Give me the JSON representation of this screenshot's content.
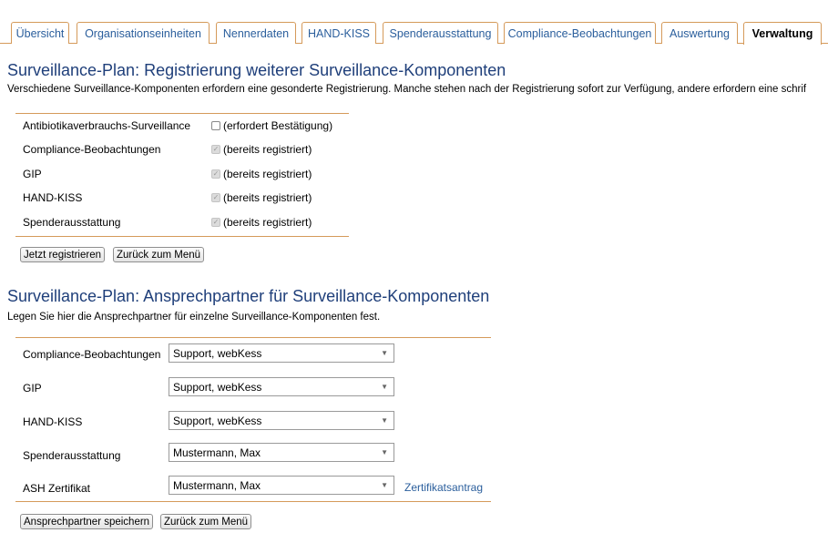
{
  "tabs": [
    {
      "label": "Übersicht"
    },
    {
      "label": "Organisationseinheiten"
    },
    {
      "label": "Nennerdaten"
    },
    {
      "label": "HAND-KISS"
    },
    {
      "label": "Spenderausstattung"
    },
    {
      "label": "Compliance-Beobachtungen"
    },
    {
      "label": "Auswertung"
    },
    {
      "label": "Verwaltung",
      "active": true
    }
  ],
  "registration": {
    "title": "Surveillance-Plan: Registrierung weiterer Surveillance-Komponenten",
    "description": "Verschiedene Surveillance-Komponenten erfordern eine gesonderte Registrierung. Manche stehen nach der Registrierung sofort zur Verfügung, andere erfordern eine schrif",
    "rows": [
      {
        "name": "Antibiotikaverbrauchs-Surveillance",
        "status": "(erfordert Bestätigung)",
        "checked": false,
        "disabled": false
      },
      {
        "name": "Compliance-Beobachtungen",
        "status": "(bereits registriert)",
        "checked": true,
        "disabled": true
      },
      {
        "name": "GIP",
        "status": "(bereits registriert)",
        "checked": true,
        "disabled": true
      },
      {
        "name": "HAND-KISS",
        "status": "(bereits registriert)",
        "checked": true,
        "disabled": true
      },
      {
        "name": "Spenderausstattung",
        "status": "(bereits registriert)",
        "checked": true,
        "disabled": true
      }
    ],
    "register_button": "Jetzt registrieren",
    "back_button": "Zurück zum Menü"
  },
  "contacts": {
    "title": "Surveillance-Plan: Ansprechpartner für Surveillance-Komponenten",
    "description": "Legen Sie hier die Ansprechpartner für einzelne Surveillance-Komponenten fest.",
    "rows": [
      {
        "name": "Compliance-Beobachtungen",
        "value": "Support, webKess"
      },
      {
        "name": "GIP",
        "value": "Support, webKess"
      },
      {
        "name": "HAND-KISS",
        "value": "Support, webKess"
      },
      {
        "name": "Spenderausstattung",
        "value": "Mustermann, Max"
      },
      {
        "name": "ASH Zertifikat",
        "value": "Mustermann, Max"
      }
    ],
    "certificate_link": "Zertifikatsantrag",
    "save_button": "Ansprechpartner speichern",
    "back_button": "Zurück zum Menü"
  },
  "icons": {
    "dropdown": "chevron-down-icon",
    "checkmark": "check-icon"
  }
}
